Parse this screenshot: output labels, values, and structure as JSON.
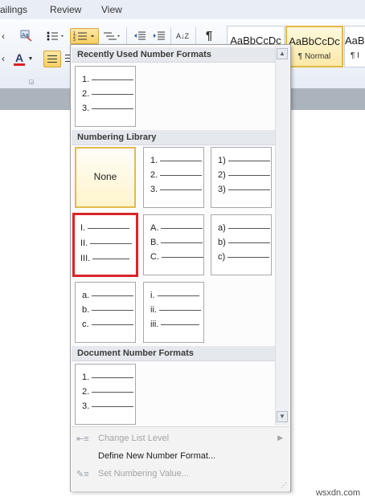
{
  "ribbon": {
    "tabs": [
      "ailings",
      "Review",
      "View"
    ],
    "buttons": {
      "font_color": "A",
      "pilcrow": "¶",
      "sort": "A↓Z"
    },
    "styles": [
      {
        "sample": "AaBbCcDc",
        "name": ""
      },
      {
        "sample": "AaBbCcDc",
        "name": "¶ Normal"
      },
      {
        "sample": "AaBl",
        "name": "¶ I"
      }
    ]
  },
  "menu": {
    "sections": {
      "recent": "Recently Used Number Formats",
      "library": "Numbering Library",
      "document": "Document Number Formats"
    },
    "recent_formats": [
      {
        "labels": [
          "1.",
          "2.",
          "3."
        ]
      }
    ],
    "library_formats": [
      {
        "none_label": "None"
      },
      {
        "labels": [
          "1.",
          "2.",
          "3."
        ]
      },
      {
        "labels": [
          "1)",
          "2)",
          "3)"
        ]
      },
      {
        "labels": [
          "I.",
          "II.",
          "III."
        ]
      },
      {
        "labels": [
          "A.",
          "B.",
          "C."
        ]
      },
      {
        "labels": [
          "a)",
          "b)",
          "c)"
        ]
      },
      {
        "labels": [
          "a.",
          "b.",
          "c."
        ]
      },
      {
        "labels": [
          "i.",
          "ii.",
          "iii."
        ]
      }
    ],
    "document_formats": [
      {
        "labels": [
          "1.",
          "2.",
          "3."
        ]
      }
    ],
    "footer": {
      "change_list_level": "Change List Level",
      "define_new": "Define New Number Format...",
      "set_value": "Set Numbering Value..."
    }
  },
  "watermark": "wsxdn.com",
  "colors": {
    "selection_border": "#e3b94b",
    "highlight_border": "#d9252b",
    "font_color_bar": "#e02020"
  }
}
